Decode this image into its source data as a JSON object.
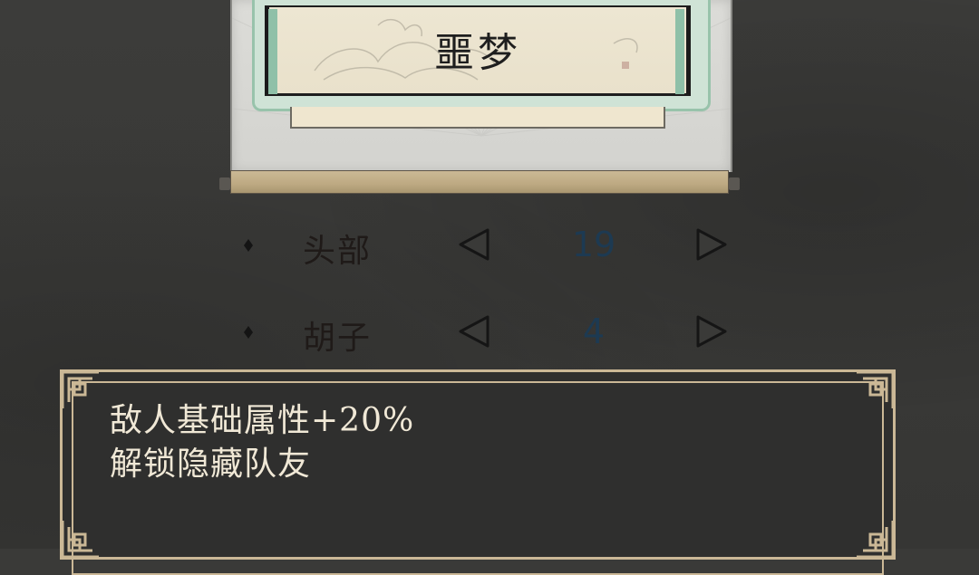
{
  "scroll": {
    "title": "噩梦"
  },
  "options": [
    {
      "label": "头部",
      "value": "19"
    },
    {
      "label": "胡子",
      "value": "4"
    }
  ],
  "info": {
    "lines": [
      "敌人基础属性+20%",
      "解锁隐藏队友"
    ]
  },
  "colors": {
    "background": "#3a3a38",
    "value_text": "#1d3a52",
    "panel_border": "#cbb896",
    "panel_text": "#f0e8d6",
    "accent_green": "#98c3ab"
  },
  "icons": {
    "bullet": "diamond-icon",
    "prev": "triangle-left-icon",
    "next": "triangle-right-icon"
  }
}
